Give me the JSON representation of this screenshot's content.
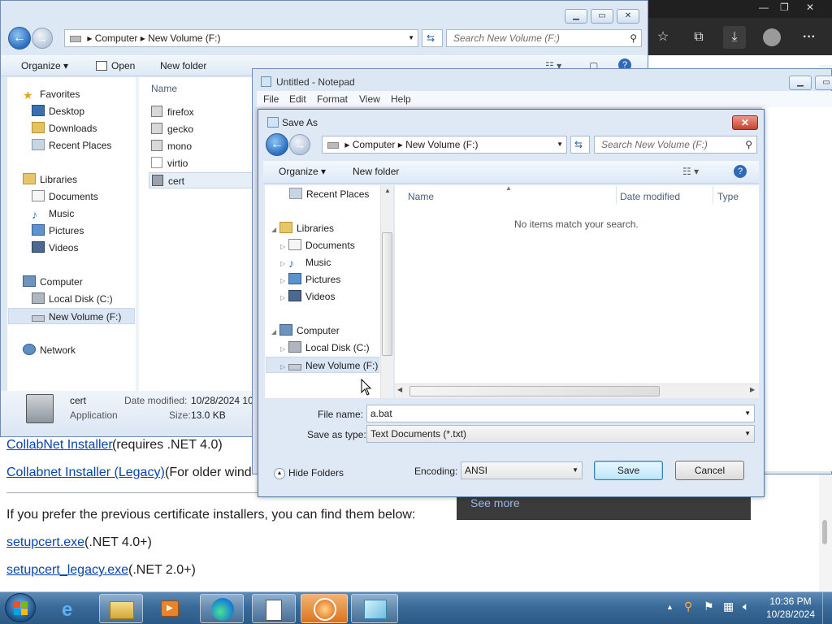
{
  "browser": {
    "toolbar_icons": [
      "favorites-star-icon",
      "collections-icon",
      "download-icon",
      "profile-avatar-icon",
      "more-menu-icon"
    ],
    "page": {
      "line1_link": "CollabNet Installer",
      "line1_text": " (requires .NET 4.0)",
      "line2_link": "Collabnet Installer (Legacy)",
      "line2_text": " (For older wind",
      "paragraph": "If you prefer the previous certificate installers, you can find them below:",
      "link3": "setupcert.exe",
      "link3_text": " (.NET 4.0+)",
      "link4": "setupcert_legacy.exe",
      "link4_text": " (.NET 2.0+)"
    },
    "see_more": "See more"
  },
  "explorer": {
    "address": {
      "seg1": "Computer",
      "seg2": "New Volume (F:)"
    },
    "search_placeholder": "Search New Volume (F:)",
    "toolbar": {
      "organize": "Organize",
      "open": "Open",
      "new_folder": "New folder"
    },
    "nav": {
      "favorites": "Favorites",
      "desktop": "Desktop",
      "downloads": "Downloads",
      "recent_places": "Recent Places",
      "libraries": "Libraries",
      "documents": "Documents",
      "music": "Music",
      "pictures": "Pictures",
      "videos": "Videos",
      "computer": "Computer",
      "local_disk": "Local Disk (C:)",
      "new_volume": "New Volume (F:)",
      "network": "Network"
    },
    "column_name": "Name",
    "files": [
      "firefox",
      "gecko",
      "mono",
      "virtio",
      "cert"
    ],
    "details": {
      "name": "cert",
      "type": "Application",
      "date_label": "Date modified:",
      "date_value": "10/28/2024 10",
      "size_label": "Size:",
      "size_value": "13.0 KB"
    }
  },
  "notepad": {
    "title": "Untitled - Notepad",
    "menu": [
      "File",
      "Edit",
      "Format",
      "View",
      "Help"
    ]
  },
  "save_as": {
    "title": "Save As",
    "address": {
      "seg1": "Computer",
      "seg2": "New Volume (F:)"
    },
    "search_placeholder": "Search New Volume (F:)",
    "toolbar": {
      "organize": "Organize",
      "new_folder": "New folder"
    },
    "tree": {
      "recent_places": "Recent Places",
      "libraries": "Libraries",
      "documents": "Documents",
      "music": "Music",
      "pictures": "Pictures",
      "videos": "Videos",
      "computer": "Computer",
      "local_disk": "Local Disk (C:)",
      "new_volume": "New Volume (F:)"
    },
    "columns": {
      "name": "Name",
      "date_modified": "Date modified",
      "type": "Type"
    },
    "empty_message": "No items match your search.",
    "file_name_label": "File name:",
    "file_name_value": "a.bat",
    "save_type_label": "Save as type:",
    "save_type_value": "Text Documents (*.txt)",
    "hide_folders": "Hide Folders",
    "encoding_label": "Encoding:",
    "encoding_value": "ANSI",
    "save_button": "Save",
    "cancel_button": "Cancel"
  },
  "taskbar": {
    "apps": [
      "internet-explorer-icon",
      "explorer-folder-icon",
      "media-player-icon",
      "edge-icon",
      "notepad-icon",
      "installer-app-icon",
      "app-icon"
    ],
    "time": "10:36 PM",
    "date": "10/28/2024"
  }
}
